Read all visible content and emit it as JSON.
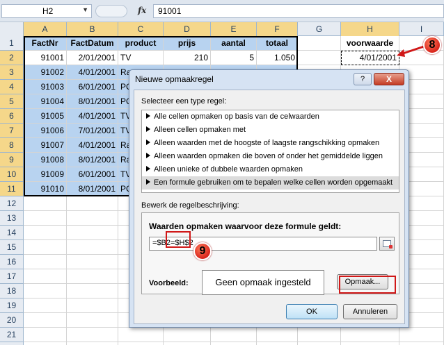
{
  "formula_bar": {
    "name_box": "H2",
    "fx_label": "fx",
    "formula": "91001"
  },
  "columns": [
    "A",
    "B",
    "C",
    "D",
    "E",
    "F",
    "G",
    "H",
    "I"
  ],
  "rows": [
    "1",
    "2",
    "3",
    "4",
    "5",
    "6",
    "7",
    "8",
    "9",
    "10",
    "11",
    "12",
    "13",
    "14",
    "15",
    "16",
    "17",
    "18",
    "19",
    "20",
    "21",
    "22"
  ],
  "sheet": {
    "headers": [
      "FactNr",
      "FactDatum",
      "product",
      "prijs",
      "aantal",
      "totaal"
    ],
    "row2": [
      "91001",
      "2/01/2001",
      "TV",
      "210",
      "5",
      "1.050"
    ],
    "partial_rows": [
      {
        "nr": "91002",
        "date": "4/01/2001",
        "prod": "Ra"
      },
      {
        "nr": "91003",
        "date": "6/01/2001",
        "prod": "PC"
      },
      {
        "nr": "91004",
        "date": "8/01/2001",
        "prod": "PC"
      },
      {
        "nr": "91005",
        "date": "4/01/2001",
        "prod": "TV"
      },
      {
        "nr": "91006",
        "date": "7/01/2001",
        "prod": "TV"
      },
      {
        "nr": "91007",
        "date": "4/01/2001",
        "prod": "Ra"
      },
      {
        "nr": "91008",
        "date": "8/01/2001",
        "prod": "Ra"
      },
      {
        "nr": "91009",
        "date": "6/01/2001",
        "prod": "TV"
      },
      {
        "nr": "91010",
        "date": "8/01/2001",
        "prod": "PC"
      }
    ],
    "h1": "voorwaarde",
    "h2": "4/01/2001"
  },
  "callouts": {
    "c8": "8",
    "c9": "9"
  },
  "dialog": {
    "title": "Nieuwe opmaakregel",
    "help": "?",
    "close": "X",
    "select_label": "Selecteer een type regel:",
    "rules": [
      "Alle cellen opmaken op basis van de celwaarden",
      "Alleen cellen opmaken met",
      "Alleen waarden met de hoogste of laagste rangschikking opmaken",
      "Alleen waarden opmaken die boven of onder het gemiddelde liggen",
      "Alleen unieke of dubbele waarden opmaken",
      "Een formule gebruiken om te bepalen welke cellen worden opgemaakt"
    ],
    "edit_label": "Bewerk de regelbeschrijving:",
    "formula_label": "Waarden opmaken waarvoor deze formule geldt:",
    "formula_value": "=$B2=$H$2",
    "preview_label": "Voorbeeld:",
    "preview_text": "Geen opmaak ingesteld",
    "format_button": "Opmaak...",
    "ok_button": "OK",
    "cancel_button": "Annuleren"
  },
  "colors": {
    "selection_fill": "#b8d3f0",
    "header_highlight": "#f5d78a",
    "callout_red": "#d8251c"
  }
}
